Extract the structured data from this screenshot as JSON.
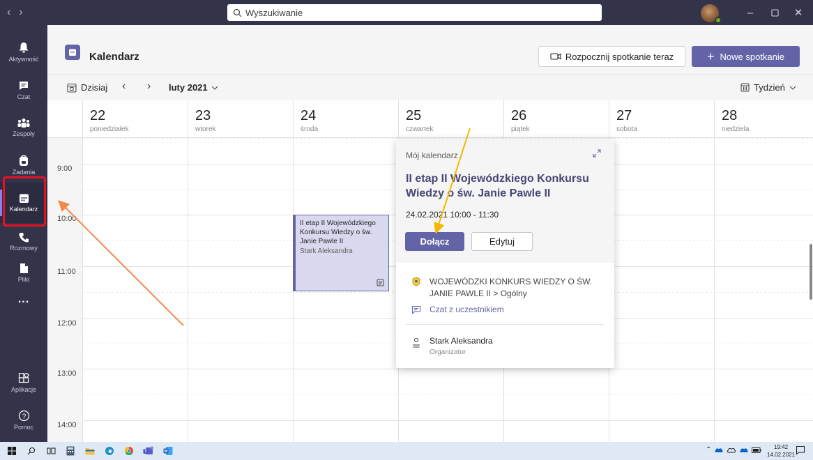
{
  "search": {
    "placeholder": "Wyszukiwanie"
  },
  "rail": {
    "items": [
      {
        "label": "Aktywność"
      },
      {
        "label": "Czat"
      },
      {
        "label": "Zespoły"
      },
      {
        "label": "Zadania"
      },
      {
        "label": "Kalendarz",
        "active": true
      },
      {
        "label": "Rozmowy"
      },
      {
        "label": "Pliki"
      },
      {
        "label": "..."
      },
      {
        "label": "Aplikacje"
      },
      {
        "label": "Pomoc"
      }
    ]
  },
  "header": {
    "title": "Kalendarz",
    "meet_now_label": "Rozpocznij spotkanie teraz",
    "new_meeting_label": "Nowe spotkanie"
  },
  "toolbar": {
    "today_label": "Dzisiaj",
    "month_label": "luty 2021",
    "view_label": "Tydzień"
  },
  "days": [
    {
      "num": "22",
      "name": "poniedziałek"
    },
    {
      "num": "23",
      "name": "wtorek"
    },
    {
      "num": "24",
      "name": "środa"
    },
    {
      "num": "25",
      "name": "czwartek"
    },
    {
      "num": "26",
      "name": "piątek"
    },
    {
      "num": "27",
      "name": "sobota"
    },
    {
      "num": "28",
      "name": "niedziela"
    }
  ],
  "times": [
    "9:00",
    "10:00",
    "11:00",
    "12:00",
    "13:00",
    "14:00"
  ],
  "event": {
    "title": "II etap II Wojewódzkiego Konkursu Wiedzy o św. Janie Pawle II",
    "organizer": "Stark Aleksandra"
  },
  "popup": {
    "calendar": "Mój kalendarz",
    "title": "II etap II Wojewódzkiego Konkursu Wiedzy o św. Janie Pawle II",
    "time": "24.02.2021 10:00 - 11:30",
    "join_label": "Dołącz",
    "edit_label": "Edytuj",
    "channel": "WOJEWÓDZKI KONKURS WIEDZY O ŚW. JANIE PAWLE II > Ogólny",
    "chat_label": "Czat z uczestnikiem",
    "organizer_name": "Stark Aleksandra",
    "organizer_role": "Organizator"
  },
  "taskbar": {
    "time": "19:42",
    "date": "14.02.2021"
  },
  "colors": {
    "brand": "#6264a7",
    "rail": "#33344a",
    "annotation_highlight": "#e81123",
    "annotation_arrow_1": "#f08a4b",
    "annotation_arrow_2": "#f5b800"
  }
}
